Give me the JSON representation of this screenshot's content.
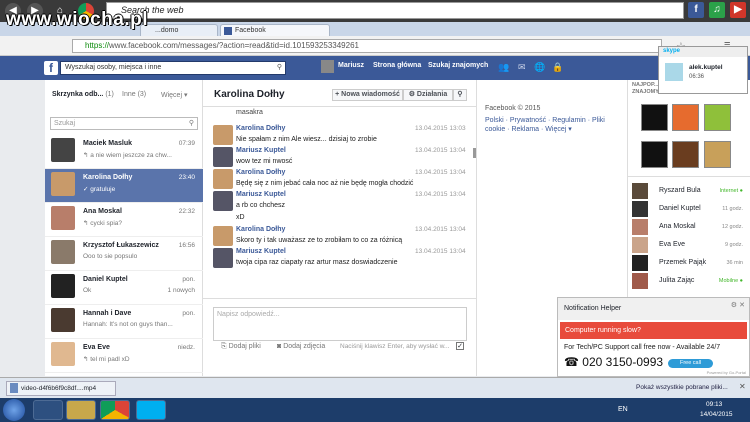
{
  "browser": {
    "search_placeholder": "Search the web",
    "logo_text": "www.wiocha.pl",
    "tabs": [
      "...domo",
      "Facebook"
    ],
    "url_secure": "https://",
    "url_rest": "www.facebook.com/messages/?action=read&tid=id.101593253349261"
  },
  "fb": {
    "search_placeholder": "Wyszukaj osoby, miejsca i inne",
    "user_name": "Mariusz",
    "nav_home": "Strona główna",
    "nav_find": "Szukaj znajomych"
  },
  "left": {
    "inbox_label": "Skrzynka odb...",
    "inbox_count": "(1)",
    "other_label": "Inne",
    "other_count": "(3)",
    "more_label": "Więcej ▾",
    "search_placeholder": "Szukaj",
    "conversations": [
      {
        "name": "Maciek Masluk",
        "time": "07:39",
        "snippet": "↰ a nie wiem jeszcze za chw...",
        "extra": ""
      },
      {
        "name": "Karolina Dołhy",
        "time": "23:40",
        "snippet": "✓ gratuluje",
        "extra": ""
      },
      {
        "name": "Ana Moskal",
        "time": "22:32",
        "snippet": "↰ cycki spia?",
        "extra": ""
      },
      {
        "name": "Krzysztof Łukaszewicz",
        "time": "16:56",
        "snippet": "Ooo to sie popsulo",
        "extra": ""
      },
      {
        "name": "Daniel Kuptel",
        "time": "pon.",
        "snippet": "Ok",
        "extra": "1 nowych"
      },
      {
        "name": "Hannah i Dave",
        "time": "pon.",
        "snippet": "Hannah: It's not on guys than...",
        "extra": ""
      },
      {
        "name": "Eva Eve",
        "time": "niedz.",
        "snippet": "↰ tel mi padl xD",
        "extra": ""
      }
    ]
  },
  "chat": {
    "title": "Karolina Dołhy",
    "new_message": "+ Nowa wiadomość",
    "actions": "⚙ Działania",
    "top_fragment": "masakra",
    "messages": [
      {
        "name": "Karolina Dołhy",
        "time": "13.04.2015 13:03",
        "lines": [
          "Nie spałam z nim Ale wiesz... dzisiaj to zrobie"
        ]
      },
      {
        "name": "Mariusz Kuptel",
        "time": "13.04.2015 13:04",
        "lines": [
          "wow tez mi nwosć"
        ]
      },
      {
        "name": "Karolina Dołhy",
        "time": "13.04.2015 13:04",
        "lines": [
          "Będę się z nim jebać  cała noc aż nie będę mogła chodzić"
        ]
      },
      {
        "name": "Mariusz Kuptel",
        "time": "13.04.2015 13:04",
        "lines": [
          "a rb co chchesz",
          "xD"
        ]
      },
      {
        "name": "Karolina Dołhy",
        "time": "13.04.2015 13:04",
        "lines": [
          "Skoro ty i tak uważasz ze to zrobiłam to co za różnicą"
        ]
      },
      {
        "name": "Mariusz Kuptel",
        "time": "13.04.2015 13:04",
        "lines": [
          "twoja cipa raz ciapaty raz artur masz doswiadczenie"
        ]
      }
    ],
    "reply_placeholder": "Napisz odpowiedź...",
    "add_files": "Dodaj pliki",
    "add_photos": "Dodaj zdjęcia",
    "send_hint": "Naciśnij klawisz Enter, aby wysłać w..."
  },
  "footer": {
    "copyright": "Facebook © 2015",
    "links1": "Polski · Prywatność · Regulamin · Pliki",
    "links2": "cookie · Reklama · Więcej ▾"
  },
  "sidebar": {
    "header1": "NAJPOP...",
    "header2": "ZNAJOMYCH",
    "friends": [
      {
        "name": "Ryszard Bula",
        "status": "Internet ●"
      },
      {
        "name": "Daniel Kuptel",
        "status": "11 godz."
      },
      {
        "name": "Ana Moskal",
        "status": "12 godz."
      },
      {
        "name": "Eva Eve",
        "status": "9 godz."
      },
      {
        "name": "Przemek Pająk",
        "status": "36 min"
      },
      {
        "name": "Julita Zając",
        "status": "Mobilne ●"
      }
    ]
  },
  "skype": {
    "user": "alek.kuptel",
    "time": "06:36"
  },
  "notification": {
    "title": "Notification Helper",
    "alert": "Computer running slow?",
    "line1": "For Tech/PC Support call free now - Available 24/7",
    "phone": "020 3150-0993",
    "badge": "Free call",
    "powered": "Powered by Go-Portal"
  },
  "download": {
    "file": "video-d4f6b6f9c8df....mp4",
    "show_all": "Pokaż wszystkie pobrane pliki..."
  },
  "taskbar": {
    "lang": "EN",
    "time": "09:13",
    "date": "14/04/2015"
  },
  "colors": {
    "fb_blue": "#3b5998",
    "selected_row": "#5a74ab",
    "alert_red": "#e84b3c"
  }
}
